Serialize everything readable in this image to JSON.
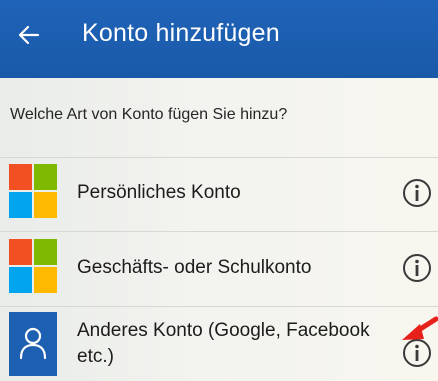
{
  "header": {
    "title": "Konto hinzufügen",
    "back_icon": "back-arrow-icon",
    "background": "#1f63b8"
  },
  "prompt": {
    "question": "Welche Art von Konto fügen Sie hinzu?"
  },
  "accounts": [
    {
      "label": "Persönliches Konto",
      "icon": "microsoft-logo-icon",
      "info_icon": "info-icon"
    },
    {
      "label": "Geschäfts- oder Schulkonto",
      "icon": "microsoft-logo-icon",
      "info_icon": "info-icon"
    },
    {
      "label_line1": "Anderes Konto (Google, Facebook",
      "label_line2": "etc.)",
      "icon": "person-icon",
      "info_icon": "info-icon"
    }
  ],
  "annotation": {
    "arrow_icon": "red-arrow-icon",
    "color": "#e8201a"
  }
}
